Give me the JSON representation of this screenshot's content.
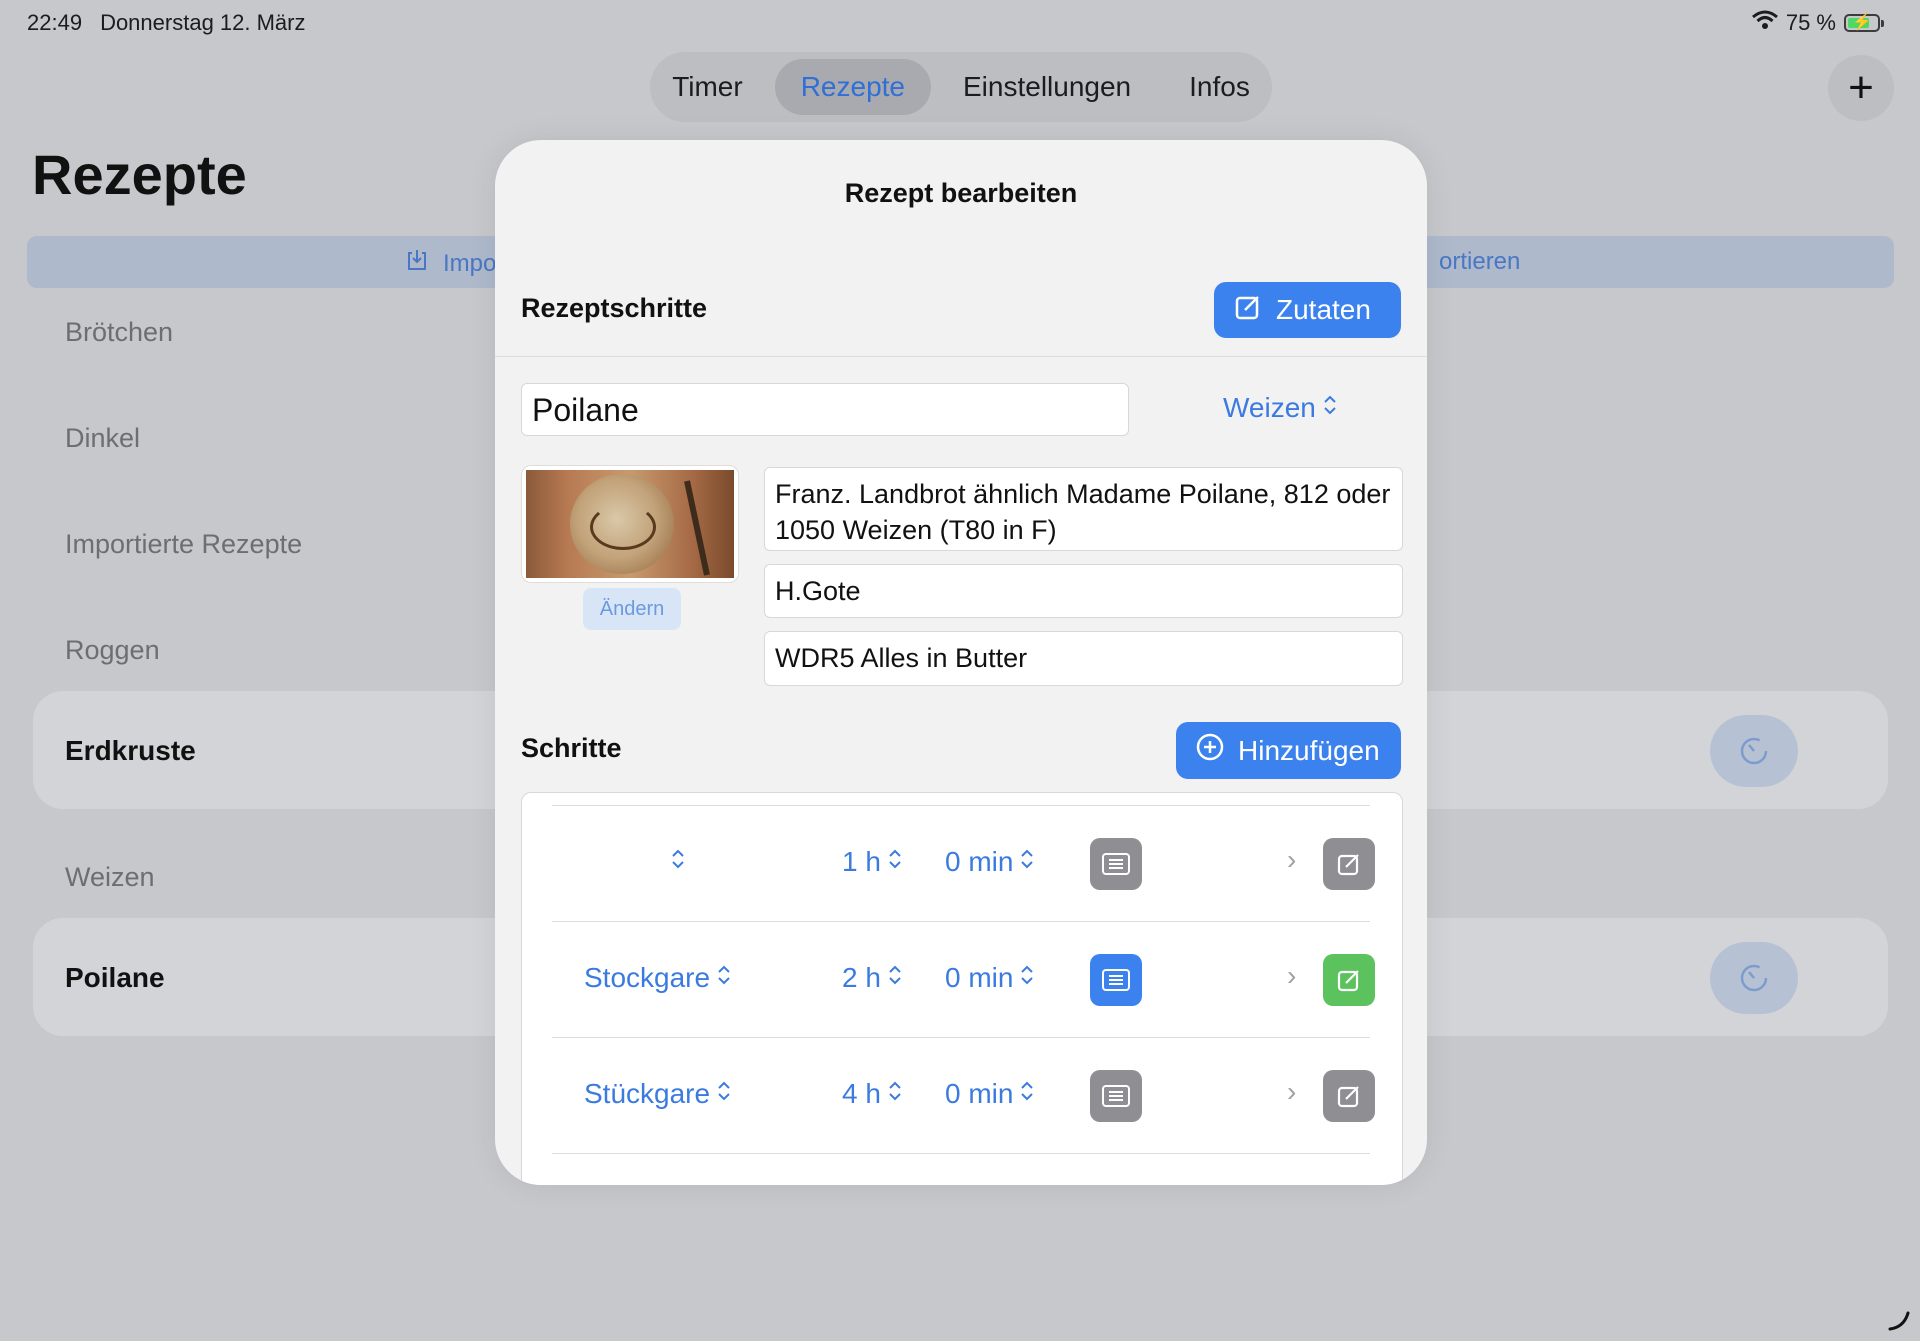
{
  "status": {
    "time": "22:49",
    "date": "Donnerstag 12. März",
    "battery": "75 %",
    "battery_level": 0.75
  },
  "tabs": [
    {
      "label": "Timer",
      "active": false
    },
    {
      "label": "Rezepte",
      "active": true
    },
    {
      "label": "Einstellungen",
      "active": false
    },
    {
      "label": "Infos",
      "active": false
    }
  ],
  "add_symbol": "+",
  "page": {
    "title": "Rezepte",
    "import_label": "Impo",
    "export_label": "ortieren",
    "groups": [
      {
        "label": "Brötchen"
      },
      {
        "label": "Dinkel"
      },
      {
        "label": "Importierte Rezepte"
      },
      {
        "label": "Roggen"
      },
      {
        "label": "Weizen"
      }
    ],
    "cards": [
      {
        "name": "Erdkruste"
      },
      {
        "name": "Poilane"
      }
    ]
  },
  "modal": {
    "title": "Rezept bearbeiten",
    "steps_section_label": "Rezeptschritte",
    "ingredients_button": "Zutaten",
    "recipe_name": "Poilane",
    "category": "Weizen",
    "change_photo_button": "Ändern",
    "description": "Franz. Landbrot ähnlich Madame Poilane, 812 oder 1050 Weizen (T80 in F)",
    "author": "H.Gote",
    "source": "WDR5 Alles in Butter",
    "steps_label": "Schritte",
    "add_button": "Hinzufügen",
    "steps": [
      {
        "phase": "",
        "hours": "1 h",
        "minutes": "0 min",
        "note_color": "grey",
        "edit_color": "grey"
      },
      {
        "phase": "Stockgare",
        "hours": "2 h",
        "minutes": "0 min",
        "note_color": "blue",
        "edit_color": "green"
      },
      {
        "phase": "Stückgare",
        "hours": "4 h",
        "minutes": "0 min",
        "note_color": "grey",
        "edit_color": "grey"
      }
    ]
  },
  "colors": {
    "accent": "#3b82ef",
    "link": "#3b7be0",
    "green": "#5cc25e",
    "grey": "#8e8e93"
  }
}
